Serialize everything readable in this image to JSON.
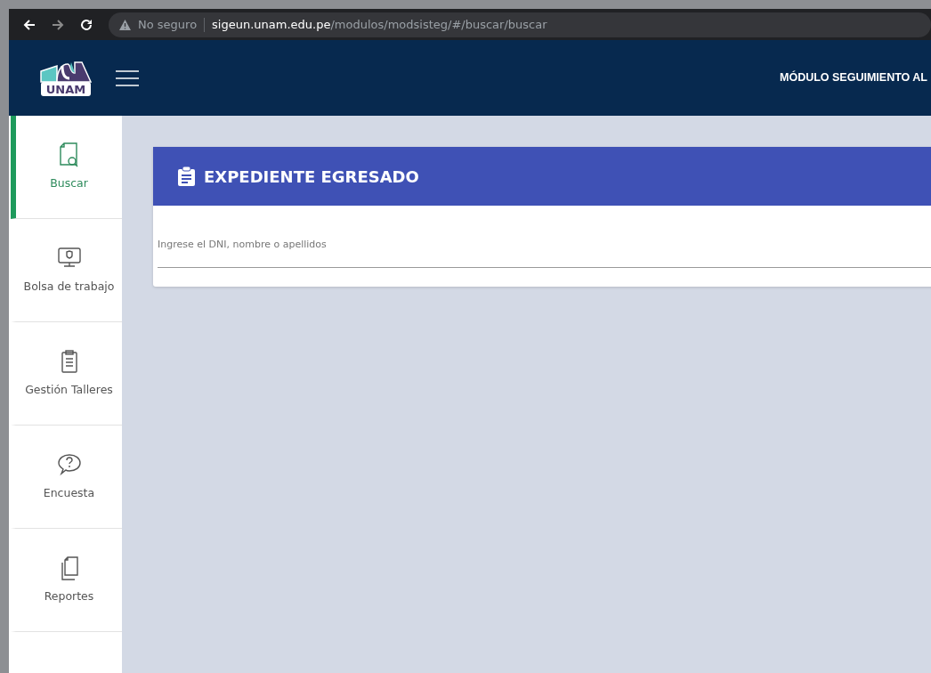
{
  "browser": {
    "security": "No seguro",
    "url_host": "sigeun.unam.edu.pe",
    "url_path": "/modulos/modsisteg/#/buscar/buscar"
  },
  "header": {
    "logo_text": "UNAM",
    "title": "MÓDULO SEGUIMIENTO AL"
  },
  "sidebar": {
    "items": [
      {
        "label": "Buscar",
        "kind": "search",
        "selected": true
      },
      {
        "label": "Bolsa de trabajo",
        "kind": "monitor",
        "selected": false
      },
      {
        "label": "Gestión Talleres",
        "kind": "clipboard",
        "selected": false
      },
      {
        "label": "Encuesta",
        "kind": "question",
        "selected": false
      },
      {
        "label": "Reportes",
        "kind": "pages",
        "selected": false
      }
    ]
  },
  "card": {
    "title": "EXPEDIENTE EGRESADO",
    "search": {
      "placeholder": "Ingrese el DNI, nombre o apellidos"
    }
  }
}
